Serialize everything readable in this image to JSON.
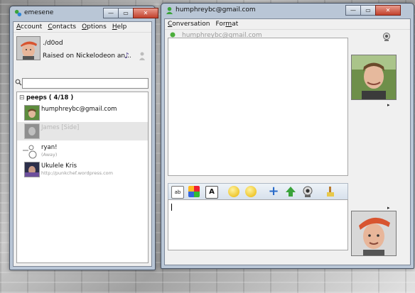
{
  "contact_list_window": {
    "title": "emesene",
    "window_controls": {
      "minimize": "—",
      "restore": "▭",
      "close": "✕"
    },
    "menu": [
      {
        "label": "Account",
        "key": "A",
        "rest": "ccount"
      },
      {
        "label": "Contacts",
        "key": "C",
        "rest": "ontacts"
      },
      {
        "label": "Options",
        "key": "O",
        "rest": "ptions"
      },
      {
        "label": "Help",
        "key": "H",
        "rest": "elp"
      }
    ],
    "profile": {
      "nick": "./d0od",
      "personal_message": "Raised on Nickelodeon an...",
      "icons": [
        "music-note-icon",
        "status-user-icon"
      ]
    },
    "search": {
      "value": ""
    },
    "group": {
      "toggle": "⊟",
      "name": "peeps ( 4/18 )"
    },
    "contacts": [
      {
        "name": "humphreybc@gmail.com",
        "message": "",
        "selected": false
      },
      {
        "name": "James [Side]",
        "message": "",
        "selected": true
      },
      {
        "name": "ryan!",
        "message": "(Away)",
        "selected": false
      },
      {
        "name": "Ukulele Kris",
        "message": "http://punkchef.wordpress.com",
        "selected": false
      }
    ]
  },
  "conversation_window": {
    "title": "humphreybc@gmail.com",
    "window_controls": {
      "minimize": "—",
      "restore": "▭",
      "close": "✕"
    },
    "menu": [
      {
        "label": "Conversation",
        "key": "C",
        "rest": "onversation"
      },
      {
        "label": "Format",
        "key": "F",
        "rest": "ormat",
        "pre": "For",
        "post": "mat",
        "underline": "m"
      }
    ],
    "header": {
      "contact": "humphreybc@gmail.com"
    },
    "toolbar": [
      "font-icon",
      "color-icon",
      "bold-text-icon",
      "emoticon-wink-icon",
      "emoticon-smile-icon",
      "invite-icon",
      "send-file-icon",
      "webcam-icon",
      "clear-icon"
    ],
    "input_value": ""
  },
  "colors": {
    "window_frame": "#b9c6d6",
    "client_bg": "#f0f0f0",
    "close_button": "#c2412c",
    "selection": "#e6e6e6"
  }
}
